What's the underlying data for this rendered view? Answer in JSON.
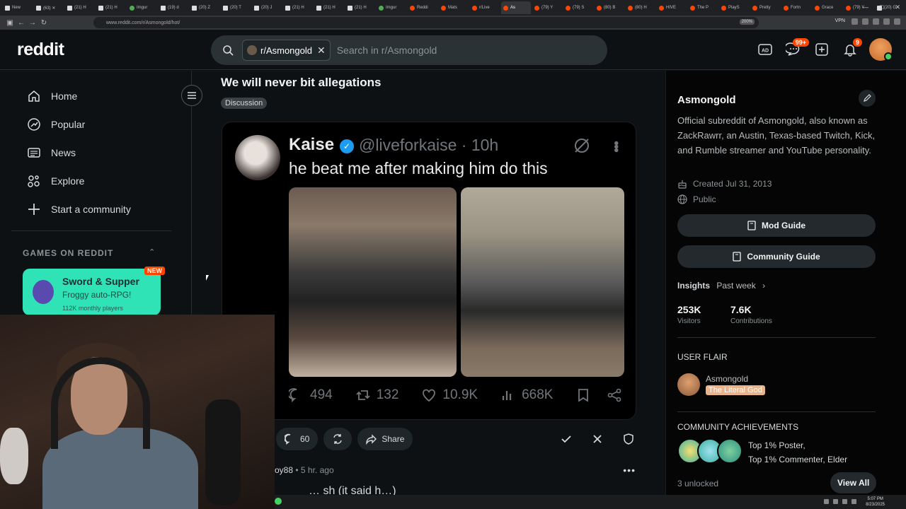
{
  "browser": {
    "tabs": [
      {
        "label": "New",
        "icon": "x"
      },
      {
        "label": "(63) ✕",
        "icon": "x"
      },
      {
        "label": "(21) H",
        "icon": "x"
      },
      {
        "label": "(21) H",
        "icon": "x"
      },
      {
        "label": "Imgur",
        "icon": "g"
      },
      {
        "label": "(19) d",
        "icon": "x"
      },
      {
        "label": "(20) Z",
        "icon": "x"
      },
      {
        "label": "(20) T",
        "icon": "x"
      },
      {
        "label": "(20) J",
        "icon": "x"
      },
      {
        "label": "(21) H",
        "icon": "x"
      },
      {
        "label": "(21) H",
        "icon": "x"
      },
      {
        "label": "(21) H",
        "icon": "x"
      },
      {
        "label": "Imgur",
        "icon": "g"
      },
      {
        "label": "Reddi",
        "icon": "r"
      },
      {
        "label": "Mats",
        "icon": "r"
      },
      {
        "label": "r/Live",
        "icon": "r"
      },
      {
        "label": "As",
        "icon": "r",
        "active": true
      },
      {
        "label": "(79) Y",
        "icon": "r"
      },
      {
        "label": "(79) S",
        "icon": "r"
      },
      {
        "label": "(80) B",
        "icon": "r"
      },
      {
        "label": "(80) H",
        "icon": "r"
      },
      {
        "label": "HIVE",
        "icon": "r"
      },
      {
        "label": "The P",
        "icon": "r"
      },
      {
        "label": "PlayS",
        "icon": "r"
      },
      {
        "label": "Pretty",
        "icon": "r"
      },
      {
        "label": "Fortn",
        "icon": "r"
      },
      {
        "label": "Grace",
        "icon": "r"
      },
      {
        "label": "(79) Y",
        "icon": "r"
      },
      {
        "label": "(20) G",
        "icon": "x"
      }
    ],
    "url": "www.reddit.com/r/Asmongold/hot/",
    "zoom": "200%",
    "vpn": "VPN"
  },
  "header": {
    "logo": "reddit",
    "search_chip": "r/Asmongold",
    "search_placeholder": "Search in r/Asmongold",
    "chat_badge": "99+",
    "notif_badge": "9"
  },
  "sidebar": {
    "items": [
      {
        "label": "Home",
        "icon": "home-icon"
      },
      {
        "label": "Popular",
        "icon": "popular-icon"
      },
      {
        "label": "News",
        "icon": "news-icon"
      },
      {
        "label": "Explore",
        "icon": "explore-icon"
      },
      {
        "label": "Start a community",
        "icon": "plus-icon"
      }
    ],
    "games_heading": "GAMES ON REDDIT",
    "game": {
      "name": "Sword & Supper",
      "subtitle": "Froggy auto-RPG!",
      "users": "112K monthly players",
      "badge": "NEW"
    }
  },
  "post": {
    "title": "We will never bit allegations",
    "flair": "Discussion",
    "tweet": {
      "name": "Kaise",
      "handle": "@liveforkaise · 10h",
      "text": "he beat me after making him do this",
      "replies": "494",
      "retweets": "132",
      "likes": "10.9K",
      "views": "668K"
    },
    "comments": "60",
    "share": "Share",
    "comment_preview": {
      "user": "oy88",
      "time": "• 5 hr. ago",
      "partial_text": "… sh (it said h…)"
    }
  },
  "subreddit": {
    "name": "Asmongold",
    "description": "Official subreddit of Asmongold, also known as ZackRawrr, an Austin, Texas-based Twitch, Kick, and Rumble streamer and YouTube personality.",
    "created": "Created Jul 31, 2013",
    "visibility": "Public",
    "mod_guide": "Mod Guide",
    "community_guide": "Community Guide",
    "insights": "Insights",
    "period": "Past week",
    "visitors_value": "253K",
    "visitors_label": "Visitors",
    "contributions_value": "7.6K",
    "contributions_label": "Contributions",
    "user_flair_heading": "USER FLAIR",
    "user_flair_name": "Asmongold",
    "user_flair_tag": "The Literal God",
    "achievements_heading": "COMMUNITY ACHIEVEMENTS",
    "achievement_line1": "Top 1% Poster,",
    "achievement_line2": "Top 1% Commenter, Elder",
    "unlocked": "3 unlocked",
    "view_all": "View All"
  },
  "taskbar": {
    "time": "5:07 PM",
    "date": "8/23/2025"
  },
  "colors": {
    "accent": "#ff4500",
    "background": "#0e1113",
    "game_card": "#2fe3b7",
    "flair": "#e9b38c",
    "verified": "#1d9bf0"
  }
}
